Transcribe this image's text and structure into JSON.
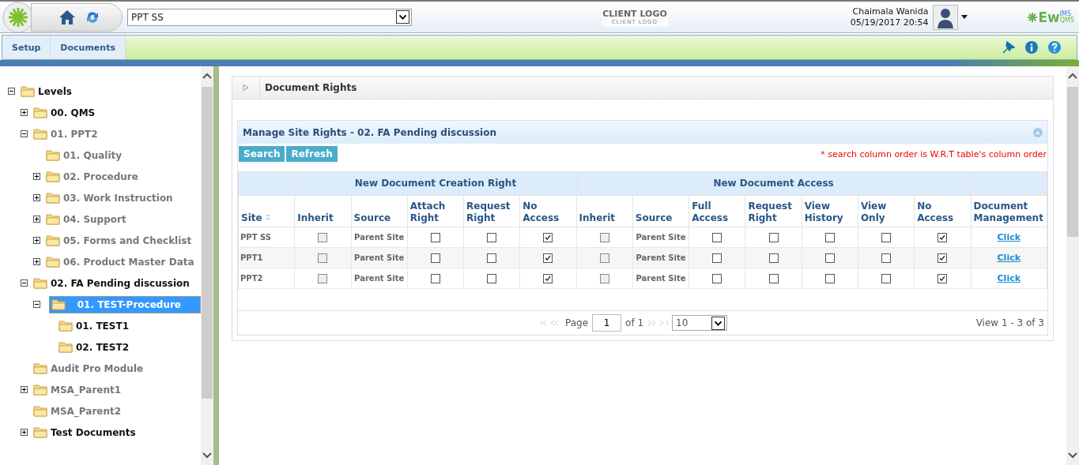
{
  "header": {
    "site_select": {
      "value": "PPT SS"
    },
    "client_logo": {
      "title": "CLIENT LOGO",
      "subtitle": "CLIENT LOGO"
    },
    "user": {
      "name": "Chaimala Wanida",
      "datetime": "05/19/2017 20:54"
    },
    "brand": {
      "main": "Ew",
      "top": "IMS",
      "bottom": "QMS"
    }
  },
  "menu": [
    {
      "label": "Setup",
      "selected": false
    },
    {
      "label": "Documents",
      "selected": false
    }
  ],
  "tree": [
    {
      "label": "Levels",
      "expanded": true,
      "dimmed": false,
      "selected": false,
      "children": [
        {
          "label": "00. QMS",
          "expanded": false,
          "dimmed": false,
          "selected": false
        },
        {
          "label": "01. PPT2",
          "expanded": true,
          "dimmed": true,
          "selected": false,
          "children": [
            {
              "label": "01. Quality",
              "dimmed": true,
              "selected": false
            },
            {
              "label": "02. Procedure",
              "expanded": false,
              "dimmed": true,
              "selected": false
            },
            {
              "label": "03. Work Instruction",
              "expanded": false,
              "dimmed": true,
              "selected": false
            },
            {
              "label": "04. Support",
              "expanded": false,
              "dimmed": true,
              "selected": false
            },
            {
              "label": "05. Forms and Checklist",
              "expanded": false,
              "dimmed": true,
              "selected": false
            },
            {
              "label": "06. Product Master Data",
              "expanded": false,
              "dimmed": true,
              "selected": false
            }
          ]
        },
        {
          "label": "02. FA Pending discussion",
          "expanded": true,
          "dimmed": false,
          "selected": false,
          "children": [
            {
              "label": "01. TEST-Procedure",
              "expanded": true,
              "dimmed": false,
              "selected": true,
              "children": [
                {
                  "label": "01. TEST1",
                  "dimmed": false,
                  "selected": false
                },
                {
                  "label": "02. TEST2",
                  "dimmed": false,
                  "selected": false
                }
              ]
            }
          ]
        },
        {
          "label": "Audit Pro Module",
          "dimmed": true,
          "selected": false
        },
        {
          "label": "MSA_Parent1",
          "expanded": false,
          "dimmed": true,
          "selected": false
        },
        {
          "label": "MSA_Parent2",
          "dimmed": true,
          "selected": false
        },
        {
          "label": "Test Documents",
          "expanded": false,
          "dimmed": false,
          "selected": false
        }
      ]
    }
  ],
  "panel": {
    "title": "Document Rights",
    "grid": {
      "title": "Manage Site Rights - 02. FA Pending discussion",
      "buttons": [
        "Search",
        "Refresh"
      ],
      "note": "* search column order is W.R.T table's column order",
      "columns": {
        "lead": "Site",
        "groups": [
          {
            "label": "New Document Creation Right",
            "columns": [
              "Inherit",
              "Source",
              "Attach Right",
              "Request Right",
              "No Access"
            ]
          },
          {
            "label": "New Document Access",
            "columns": [
              "Inherit",
              "Source",
              "Full Access",
              "Request Right",
              "View History",
              "View Only",
              "No Access"
            ]
          }
        ],
        "trail": "Document Management"
      },
      "rows": [
        {
          "cells": [
            {
              "kind": "text",
              "text": "PPT SS"
            },
            {
              "kind": "checkbox",
              "checked": false,
              "disabled": true
            },
            {
              "kind": "text",
              "text": "Parent Site"
            },
            {
              "kind": "checkbox",
              "checked": false,
              "disabled": false
            },
            {
              "kind": "checkbox",
              "checked": false,
              "disabled": false
            },
            {
              "kind": "checkbox",
              "checked": true,
              "disabled": false
            },
            {
              "kind": "checkbox",
              "checked": false,
              "disabled": true
            },
            {
              "kind": "text",
              "text": "Parent Site"
            },
            {
              "kind": "checkbox",
              "checked": false,
              "disabled": false
            },
            {
              "kind": "checkbox",
              "checked": false,
              "disabled": false
            },
            {
              "kind": "checkbox",
              "checked": false,
              "disabled": false
            },
            {
              "kind": "checkbox",
              "checked": false,
              "disabled": false
            },
            {
              "kind": "checkbox",
              "checked": true,
              "disabled": false
            },
            {
              "kind": "link",
              "text": "Click"
            }
          ]
        },
        {
          "cells": [
            {
              "kind": "text",
              "text": "PPT1"
            },
            {
              "kind": "checkbox",
              "checked": false,
              "disabled": true
            },
            {
              "kind": "text",
              "text": "Parent Site"
            },
            {
              "kind": "checkbox",
              "checked": false,
              "disabled": false
            },
            {
              "kind": "checkbox",
              "checked": false,
              "disabled": false
            },
            {
              "kind": "checkbox",
              "checked": true,
              "disabled": false
            },
            {
              "kind": "checkbox",
              "checked": false,
              "disabled": true
            },
            {
              "kind": "text",
              "text": "Parent Site"
            },
            {
              "kind": "checkbox",
              "checked": false,
              "disabled": false
            },
            {
              "kind": "checkbox",
              "checked": false,
              "disabled": false
            },
            {
              "kind": "checkbox",
              "checked": false,
              "disabled": false
            },
            {
              "kind": "checkbox",
              "checked": false,
              "disabled": false
            },
            {
              "kind": "checkbox",
              "checked": true,
              "disabled": false
            },
            {
              "kind": "link",
              "text": "Click"
            }
          ]
        },
        {
          "cells": [
            {
              "kind": "text",
              "text": "PPT2"
            },
            {
              "kind": "checkbox",
              "checked": false,
              "disabled": true
            },
            {
              "kind": "text",
              "text": "Parent Site"
            },
            {
              "kind": "checkbox",
              "checked": false,
              "disabled": false
            },
            {
              "kind": "checkbox",
              "checked": false,
              "disabled": false
            },
            {
              "kind": "checkbox",
              "checked": true,
              "disabled": false
            },
            {
              "kind": "checkbox",
              "checked": false,
              "disabled": true
            },
            {
              "kind": "text",
              "text": "Parent Site"
            },
            {
              "kind": "checkbox",
              "checked": false,
              "disabled": false
            },
            {
              "kind": "checkbox",
              "checked": false,
              "disabled": false
            },
            {
              "kind": "checkbox",
              "checked": false,
              "disabled": false
            },
            {
              "kind": "checkbox",
              "checked": false,
              "disabled": false
            },
            {
              "kind": "checkbox",
              "checked": true,
              "disabled": false
            },
            {
              "kind": "link",
              "text": "Click"
            }
          ]
        }
      ],
      "pager": {
        "page_label": "Page",
        "page": "1",
        "of": "of 1",
        "page_size": "10",
        "summary": "View 1 - 3 of 3"
      }
    }
  }
}
